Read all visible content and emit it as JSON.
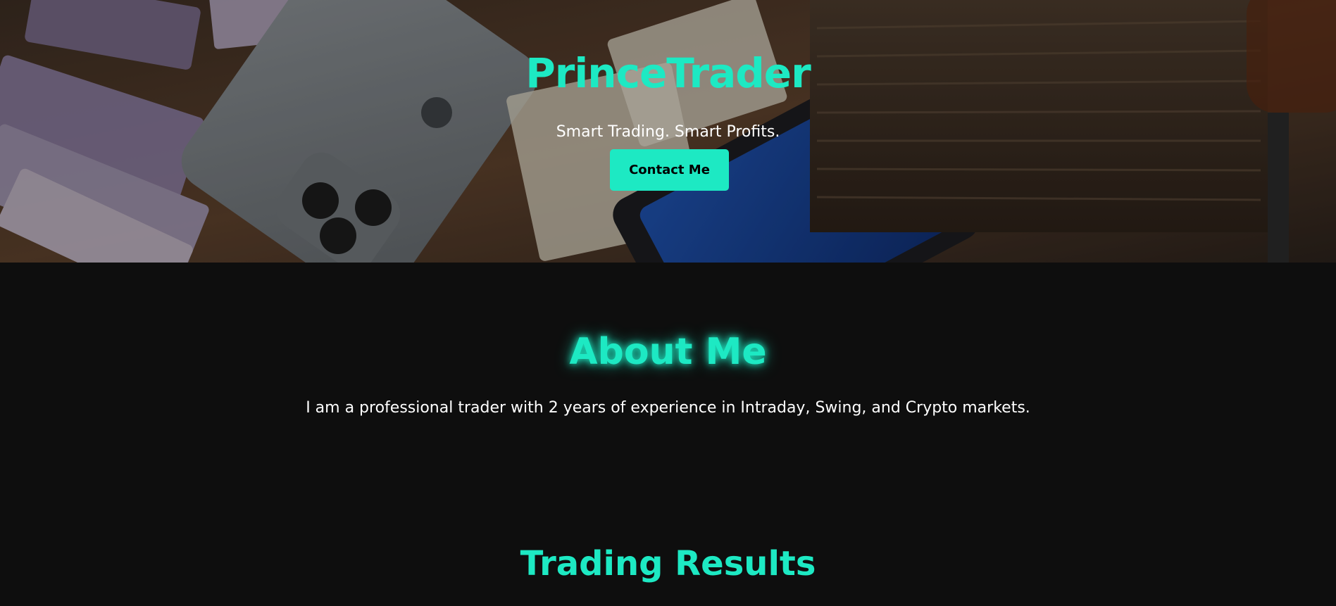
{
  "hero": {
    "brand": "PrinceTrader",
    "tagline": "Smart Trading. Smart Profits.",
    "contact_button": "Contact Me",
    "background_image": "money-phone-icon"
  },
  "about": {
    "title": "About Me",
    "text": "I am a professional trader with 2 years of experience in Intraday, Swing, and Crypto markets."
  },
  "results": {
    "title": "Trading Results"
  },
  "colors": {
    "accent": "#1de9c3",
    "background": "#0e0e0e",
    "text": "#ffffff",
    "button_text": "#000000"
  }
}
